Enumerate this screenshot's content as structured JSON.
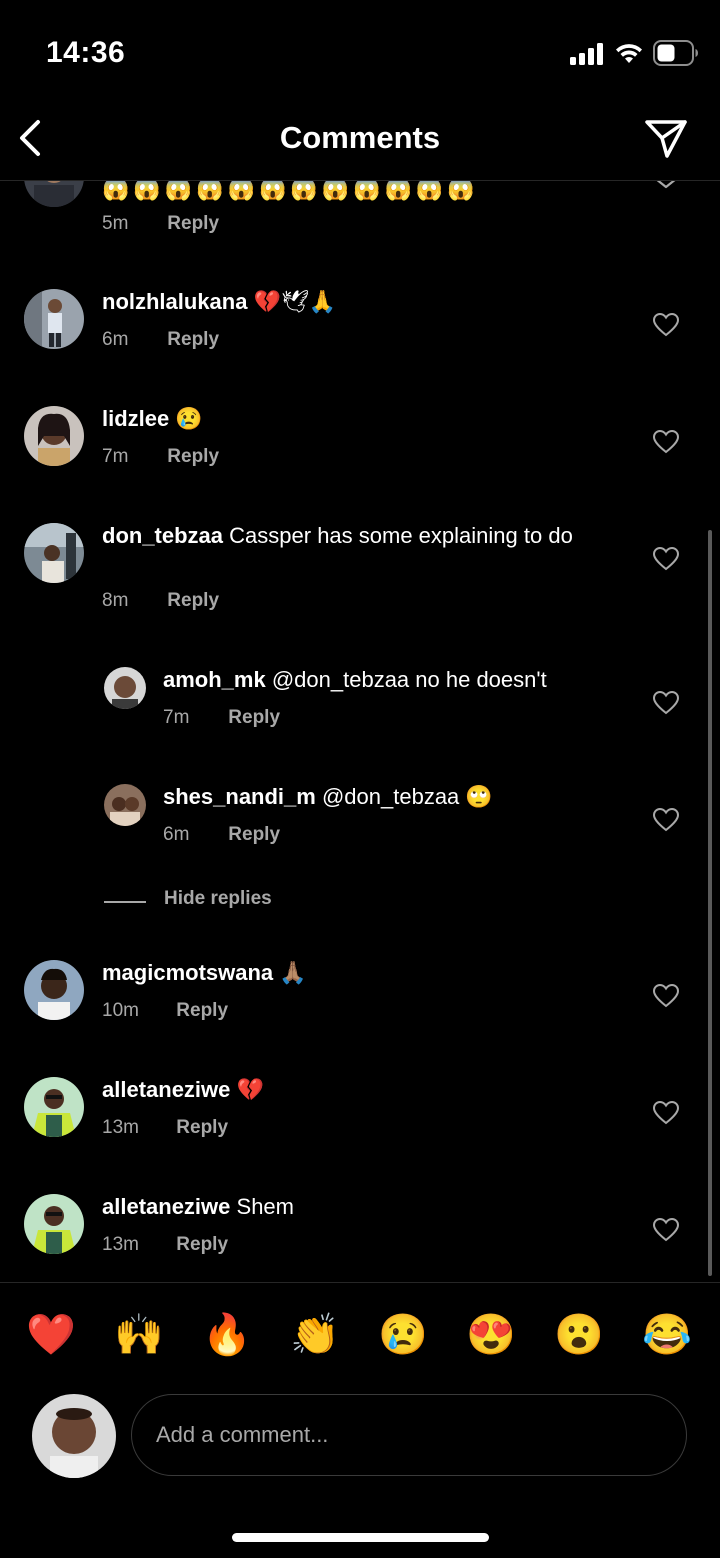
{
  "status": {
    "time": "14:36"
  },
  "header": {
    "title": "Comments"
  },
  "comments": [
    {
      "username": "",
      "text": "",
      "emoji": "😱😱😱😱😱😱😱😱😱😱😱😱",
      "time": "5m",
      "reply": "Reply"
    },
    {
      "username": "nolzhlalukana",
      "text": "",
      "emoji": "💔🕊🙏",
      "time": "6m",
      "reply": "Reply"
    },
    {
      "username": "lidzlee",
      "text": "",
      "emoji": "😢",
      "time": "7m",
      "reply": "Reply"
    },
    {
      "username": "don_tebzaa",
      "text": "Cassper has some explaining to do",
      "emoji": "",
      "time": "8m",
      "reply": "Reply"
    },
    {
      "username": "amoh_mk",
      "text": "@don_tebzaa no he doesn't",
      "emoji": "",
      "time": "7m",
      "reply": "Reply"
    },
    {
      "username": "shes_nandi_m",
      "text": "@don_tebzaa",
      "emoji": "🙄",
      "time": "6m",
      "reply": "Reply"
    },
    {
      "username": "magicmotswana",
      "text": "",
      "emoji": "🙏🏽",
      "time": "10m",
      "reply": "Reply"
    },
    {
      "username": "alletaneziwe",
      "text": "",
      "emoji": "💔",
      "time": "13m",
      "reply": "Reply"
    },
    {
      "username": "alletaneziwe",
      "text": "Shem",
      "emoji": "",
      "time": "13m",
      "reply": "Reply"
    }
  ],
  "hide_replies": "Hide replies",
  "quick_emojis": [
    "❤️",
    "🙌",
    "🔥",
    "👏",
    "😢",
    "😍",
    "😮",
    "😂"
  ],
  "composer": {
    "placeholder": "Add a comment..."
  },
  "colors": {
    "background": "#000000",
    "text": "#ffffff",
    "secondary": "#a8a8a8"
  }
}
